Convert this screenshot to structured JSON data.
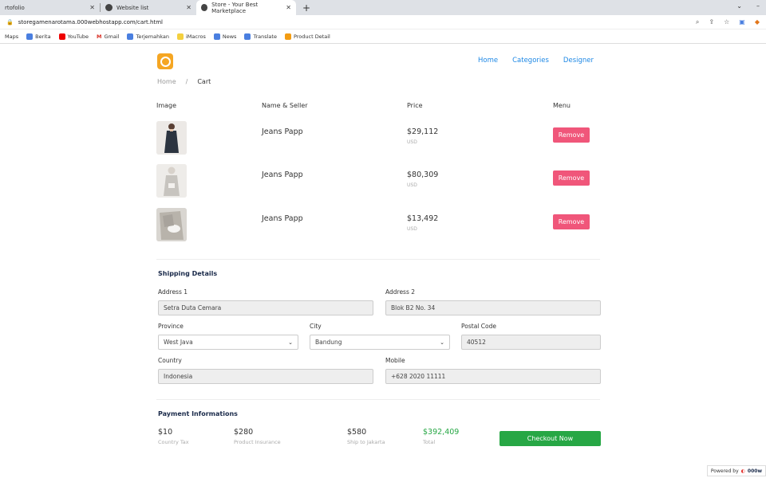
{
  "browser": {
    "tabs": [
      {
        "label": "rtofolio",
        "active": false
      },
      {
        "label": "Website list",
        "active": false
      },
      {
        "label": "Store - Your Best Marketplace",
        "active": true
      }
    ],
    "url": "storegamenarotama.000webhostapp.com/cart.html",
    "bookmarks": [
      "Maps",
      "Berita",
      "YouTube",
      "Gmail",
      "Terjemahkan",
      "iMacros",
      "News",
      "Translate",
      "Product Detail"
    ]
  },
  "nav": {
    "items": [
      "Home",
      "Categories",
      "Designer"
    ]
  },
  "breadcrumb": {
    "home": "Home",
    "sep": "/",
    "current": "Cart"
  },
  "cart": {
    "headers": {
      "image": "Image",
      "name": "Name & Seller",
      "price": "Price",
      "menu": "Menu"
    },
    "items": [
      {
        "name": "Jeans Papp",
        "price": "$29,112",
        "currency": "USD",
        "action": "Remove"
      },
      {
        "name": "Jeans Papp",
        "price": "$80,309",
        "currency": "USD",
        "action": "Remove"
      },
      {
        "name": "Jeans Papp",
        "price": "$13,492",
        "currency": "USD",
        "action": "Remove"
      }
    ]
  },
  "shipping": {
    "title": "Shipping Details",
    "address1": {
      "label": "Address 1",
      "value": "Setra Duta Cemara"
    },
    "address2": {
      "label": "Address 2",
      "value": "Blok B2 No. 34"
    },
    "province": {
      "label": "Province",
      "value": "West Java"
    },
    "city": {
      "label": "City",
      "value": "Bandung"
    },
    "postal": {
      "label": "Postal Code",
      "value": "40512"
    },
    "country": {
      "label": "Country",
      "value": "Indonesia"
    },
    "mobile": {
      "label": "Mobile",
      "value": "+628 2020 11111"
    }
  },
  "payment": {
    "title": "Payment Informations",
    "items": [
      {
        "value": "$10",
        "label": "Country Tax"
      },
      {
        "value": "$280",
        "label": "Product Insurance"
      },
      {
        "value": "$580",
        "label": "Ship to Jakarta"
      },
      {
        "value": "$392,409",
        "label": "Total"
      }
    ],
    "checkout": "Checkout Now"
  },
  "footer": {
    "powered_by": "Powered by",
    "brand": "000w"
  },
  "colors": {
    "accent": "#1e88e5",
    "remove": "#f0567a",
    "checkout": "#27a745",
    "total": "#27a745",
    "logo": "#f5a623"
  }
}
